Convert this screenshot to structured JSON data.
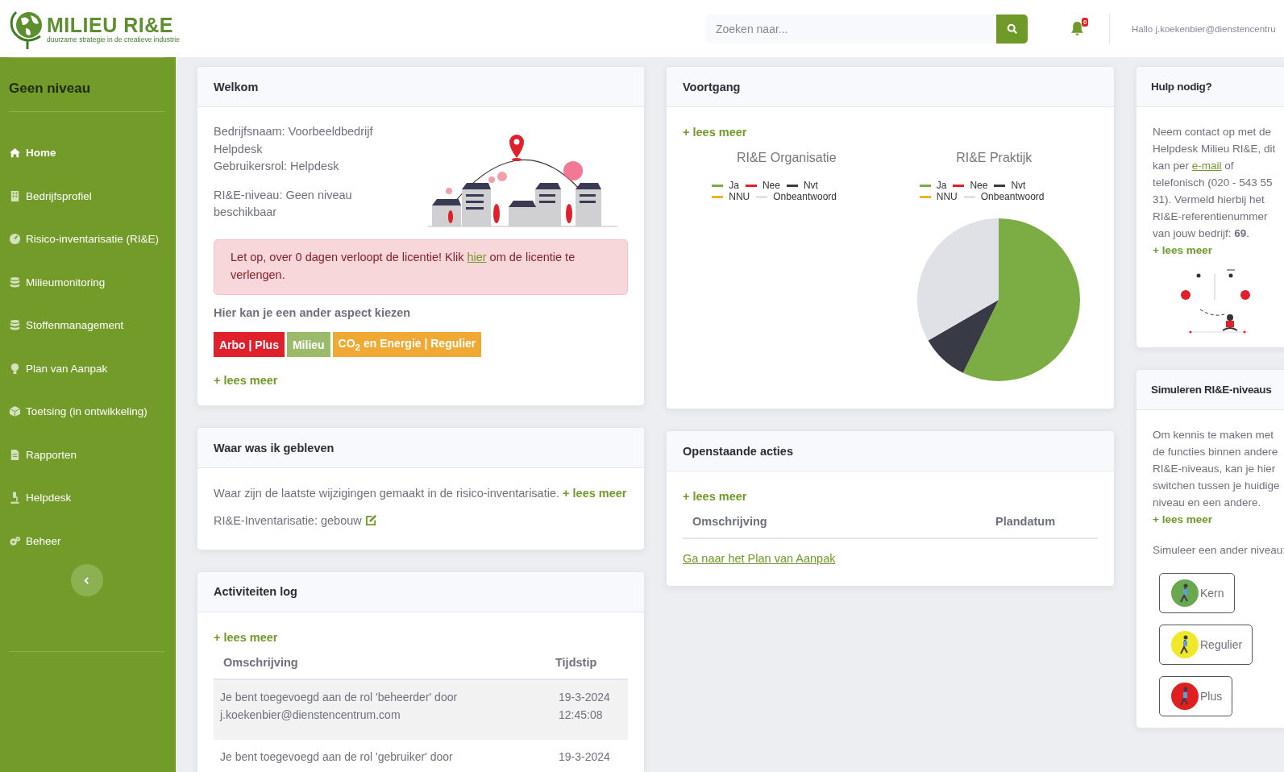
{
  "header": {
    "logo": {
      "title": "MILIEU RI&E",
      "tagline": "duurzame strategie in de creatieve industrie"
    },
    "search": {
      "placeholder": "Zoeken naar..."
    },
    "notifications": {
      "count": "0"
    },
    "user": "Hallo j.koekenbier@dienstencentru"
  },
  "sidebar": {
    "level": "Geen niveau",
    "items": [
      {
        "label": "Home",
        "kind": "home",
        "selected": true
      },
      {
        "label": "Bedrijfsprofiel",
        "kind": "building",
        "selected": false
      },
      {
        "label": "Risico-inventarisatie (RI&E)",
        "kind": "gauge",
        "selected": false
      },
      {
        "label": "Milieumonitoring",
        "kind": "database",
        "selected": false
      },
      {
        "label": "Stoffenmanagement",
        "kind": "database",
        "selected": false
      },
      {
        "label": "Plan van Aanpak",
        "kind": "bulb",
        "selected": false
      },
      {
        "label": "Toetsing (in ontwikkeling)",
        "kind": "cube",
        "selected": false
      },
      {
        "label": "Rapporten",
        "kind": "file",
        "selected": false
      },
      {
        "label": "Helpdesk",
        "kind": "microscope",
        "selected": false
      },
      {
        "label": "Beheer",
        "kind": "gears",
        "selected": false
      }
    ]
  },
  "welcome": {
    "title": "Welkom",
    "info": [
      "Bedrijfsnaam: Voorbeeldbedrijf Helpdesk",
      "Gebruikersrol: Helpdesk"
    ],
    "level_text": "RI&E-niveau: Geen niveau beschikbaar",
    "alert": {
      "before": "Let op, over 0 dagen verloopt de licentie! Klik ",
      "link": "hier",
      "after": " om de licentie te verlengen."
    },
    "aspect_heading": "Hier kan je een ander aspect kiezen",
    "aspects": [
      {
        "label": "Arbo | Plus",
        "color": "#e0202a"
      },
      {
        "label": "Milieu",
        "color": "#9bbb6b"
      },
      {
        "label": "CO$_{2}$ en Energie | Regulier",
        "color": "#f0aa33"
      }
    ],
    "more": "+ lees meer"
  },
  "recent": {
    "title": "Waar was ik gebleven",
    "text": "Waar zijn de laatste wijzigingen gemaakt in de risico-inventarisatie.",
    "more": "+ lees meer",
    "item": "RI&E-Inventarisatie: gebouw"
  },
  "log": {
    "title": "Activiteiten log",
    "more": "+ lees meer",
    "columns": [
      "Omschrijving",
      "Tijdstip"
    ],
    "rows": [
      [
        "Je bent toegevoegd aan de rol 'beheerder' door j.koekenbier@dienstencentrum.com",
        "19-3-2024 12:45:08"
      ],
      [
        "Je bent toegevoegd aan de rol 'gebruiker' door",
        "19-3-2024"
      ]
    ]
  },
  "progress": {
    "title": "Voortgang",
    "more": "+ lees meer",
    "charts": [
      {
        "title": "RI&E Organisatie",
        "kind": "empty",
        "legend": [
          {
            "label": "Ja",
            "color": "#7cad45"
          },
          {
            "label": "Nee",
            "color": "#e0202a"
          },
          {
            "label": "Nvt",
            "color": "#383a45"
          },
          {
            "label": "NNU",
            "color": "#f0b429"
          },
          {
            "label": "Onbeantwoord",
            "color": "#dfe1e6"
          }
        ]
      },
      {
        "title": "RI&E Praktijk",
        "kind": "pie",
        "legend": [
          {
            "label": "Ja",
            "color": "#7cad45"
          },
          {
            "label": "Nee",
            "color": "#e0202a"
          },
          {
            "label": "Nvt",
            "color": "#383a45"
          },
          {
            "label": "NNU",
            "color": "#f0b429"
          },
          {
            "label": "Onbeantwoord",
            "color": "#dfe1e6"
          }
        ]
      }
    ]
  },
  "actions": {
    "title": "Openstaande acties",
    "more": "+ lees meer",
    "columns": [
      "Omschrijving",
      "Plandatum"
    ],
    "link": "Ga naar het Plan van Aanpak"
  },
  "help": {
    "title": "Hulp nodig?",
    "before": "Neem contact op met de Helpdesk Milieu RI&E, dit kan per ",
    "link": "e-mail",
    "after": " of telefonisch (020 - 543 55 31). Vermeld hierbij het RI&E-referentienummer van jouw bedrijf: **69**.",
    "more": "+ lees meer"
  },
  "simulate": {
    "title": "Simuleren RI&E-niveaus",
    "text": "Om kennis te maken met de functies binnen andere RI&E-niveaus, kan je hier switchen tussen je huidige niveau en een andere.",
    "more": "+ lees meer",
    "prompt": "Simuleer een ander niveau:",
    "levels": [
      {
        "label": "Kern",
        "color": "#6aa84f"
      },
      {
        "label": "Regulier",
        "color": "#f2e82a"
      },
      {
        "label": "Plus",
        "color": "#e02020"
      }
    ]
  }
}
